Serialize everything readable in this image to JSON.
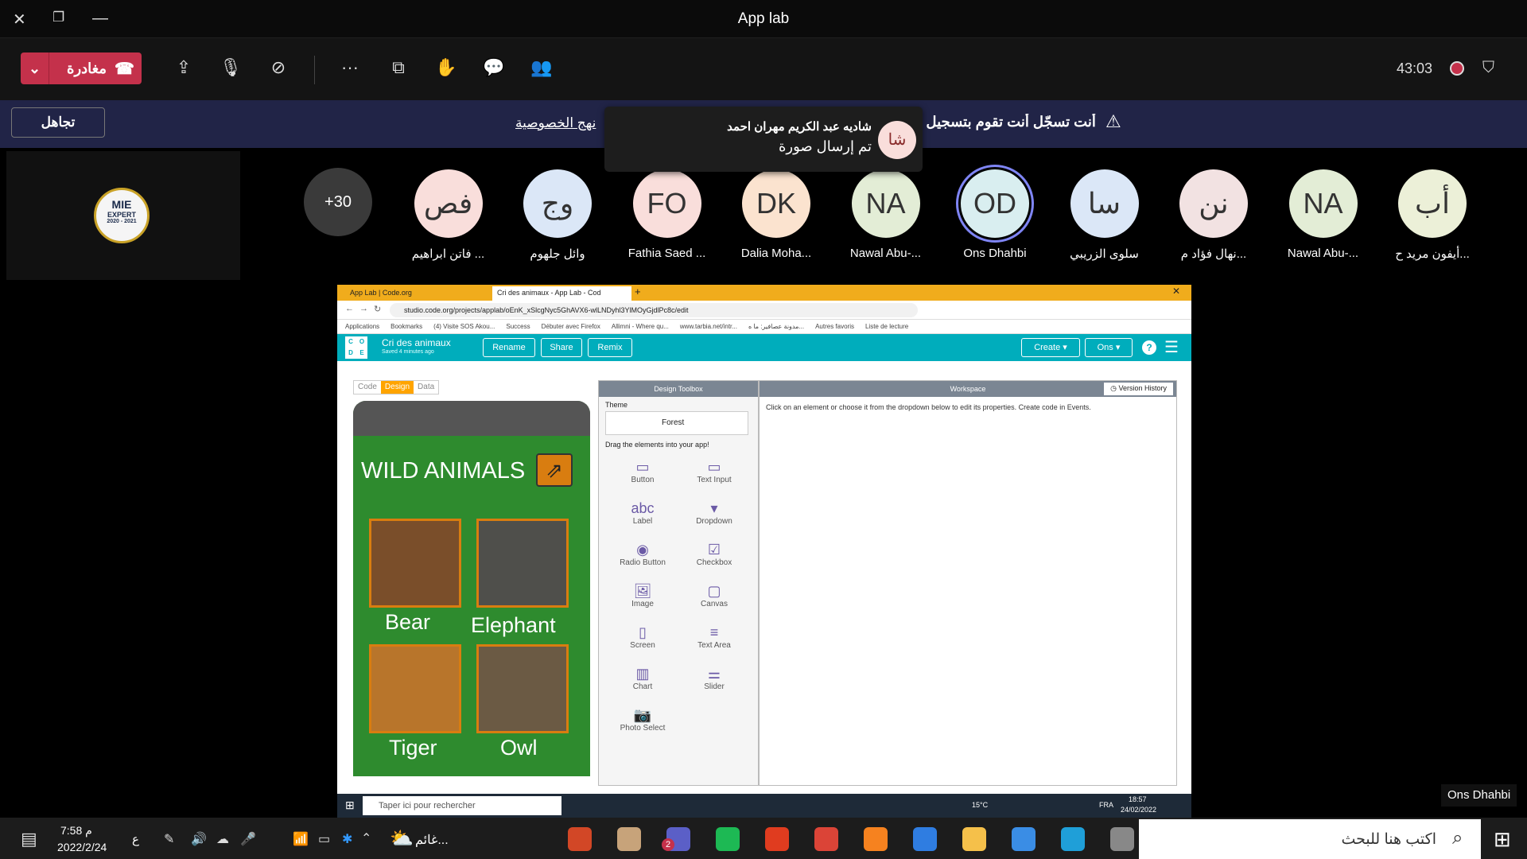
{
  "window": {
    "title": "App lab"
  },
  "toolbar": {
    "leave_label": "مغادرة",
    "timer": "43:03"
  },
  "banner": {
    "text": "أنت تسجّل  أنت تقوم بتسجيل ه",
    "privacy_link": "نهج الخصوصية",
    "ignore_label": "تجاهل"
  },
  "toast": {
    "initials": "شا",
    "name": "شاديه عبد الكريم مهران احمد",
    "message": "تم إرسال صورة"
  },
  "self": {
    "badge_line1": "MIE",
    "badge_line2": "EXPERT",
    "badge_years": "2020 - 2021"
  },
  "overflow": {
    "label": "+30"
  },
  "participants": [
    {
      "initials": "فص",
      "name": "فاتن ابراهيم ...",
      "color": "#f9dedb"
    },
    {
      "initials": "وج",
      "name": "وائل جلهوم",
      "color": "#dbe7f7"
    },
    {
      "initials": "FO",
      "name": "Fathia Saed ...",
      "color": "#f9dedb"
    },
    {
      "initials": "DK",
      "name": "Dalia Moha...",
      "color": "#fbe3cf"
    },
    {
      "initials": "NA",
      "name": "Nawal Abu-...",
      "color": "#e3edd6"
    },
    {
      "initials": "OD",
      "name": "Ons Dhahbi",
      "color": "#d9eef0"
    },
    {
      "initials": "سا",
      "name": "سلوى الزريبي",
      "color": "#dbe7f7"
    },
    {
      "initials": "نن",
      "name": "نهال فؤاد م...",
      "color": "#f2e2e2"
    },
    {
      "initials": "NA",
      "name": "Nawal Abu-...",
      "color": "#e3edd6"
    },
    {
      "initials": "أب",
      "name": "أيفون مريد ح...",
      "color": "#ecf0d8"
    }
  ],
  "browser": {
    "tab1": "App Lab | Code.org",
    "tab2": "Cri des animaux - App Lab - Cod",
    "url": "studio.code.org/projects/applab/oEnK_xSlcgNyc5GhAVX6-wlLNDyhl3YlMOyGjdlPc8c/edit",
    "bookmarks": [
      "Applications",
      "Bookmarks",
      "(4) Visite SOS Akou...",
      "Success",
      "Débuter avec Firefox",
      "Allimni - Where qu...",
      "www.tarbia.net/intr...",
      "مدونة عصافير: ما ه...",
      "Autres favoris",
      "Liste de lecture"
    ]
  },
  "applab": {
    "project": "Cri des animaux",
    "saved": "Saved 4 minutes ago",
    "rename": "Rename",
    "share": "Share",
    "remix": "Remix",
    "create": "Create",
    "user": "Ons",
    "tabs": {
      "code": "Code",
      "design": "Design",
      "data": "Data"
    },
    "app_title": "WILD ANIMALS",
    "animals": [
      "Bear",
      "Elephant",
      "Tiger",
      "Owl"
    ],
    "toolbox_title": "Design Toolbox",
    "theme_label": "Theme",
    "theme_value": "Forest",
    "drag_label": "Drag the elements into your app!",
    "elements": [
      "Button",
      "Text Input",
      "Label",
      "Dropdown",
      "Radio Button",
      "Checkbox",
      "Image",
      "Canvas",
      "Screen",
      "Text Area",
      "Chart",
      "Slider",
      "Photo Select"
    ],
    "workspace_title": "Workspace",
    "version_history": "Version History",
    "workspace_hint": "Click on an element or choose it from the dropdown below to edit its properties. Create code in Events."
  },
  "inner_taskbar": {
    "search": "Taper ici pour rechercher",
    "temp": "15°C",
    "lang": "FRA",
    "time": "18:57",
    "date": "24/02/2022"
  },
  "presenter_label": "Ons Dhahbi",
  "taskbar": {
    "time": "7:58 م",
    "date": "2022/2/24",
    "lang": "ع",
    "weather": "غائم...",
    "search": "اكتب هنا للبحث",
    "teams_badge": "2"
  }
}
